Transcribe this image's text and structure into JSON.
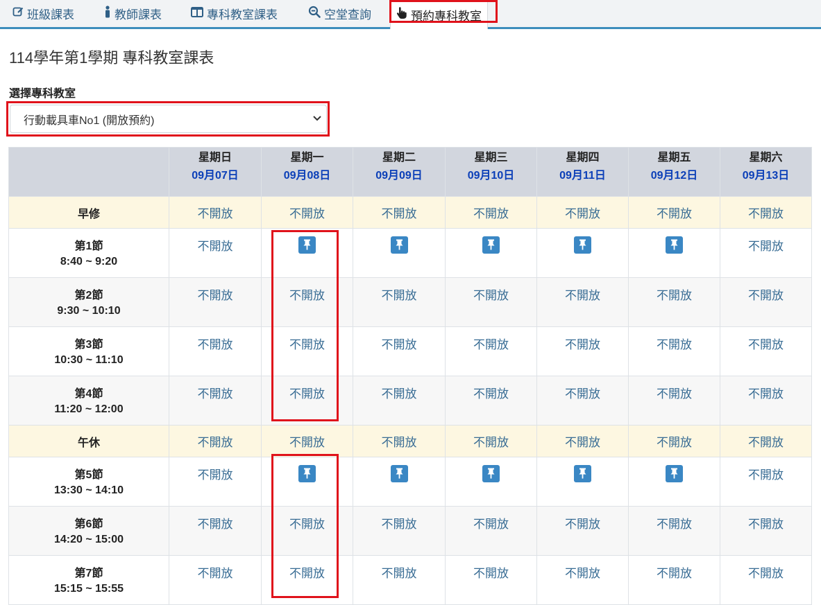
{
  "tabs": [
    {
      "label": "班級課表",
      "icon": "edit-square-icon"
    },
    {
      "label": "教師課表",
      "icon": "person-icon"
    },
    {
      "label": "專科教室課表",
      "icon": "columns-icon"
    },
    {
      "label": "空堂查詢",
      "icon": "zoom-out-icon"
    },
    {
      "label": "預約專科教室",
      "icon": "hand-pointer-icon"
    }
  ],
  "page": {
    "title": "114學年第1學期 專科教室課表",
    "select_label": "選擇專科教室",
    "selected_room": "行動載具車No1 (開放預約)"
  },
  "table": {
    "days": [
      {
        "name": "星期日",
        "date": "09月07日"
      },
      {
        "name": "星期一",
        "date": "09月08日"
      },
      {
        "name": "星期二",
        "date": "09月09日"
      },
      {
        "name": "星期三",
        "date": "09月10日"
      },
      {
        "name": "星期四",
        "date": "09月11日"
      },
      {
        "name": "星期五",
        "date": "09月12日"
      },
      {
        "name": "星期六",
        "date": "09月13日"
      }
    ],
    "closed_text": "不開放",
    "rows": [
      {
        "name": "早修",
        "time": "",
        "special": true,
        "cells": [
          "closed",
          "closed",
          "closed",
          "closed",
          "closed",
          "closed",
          "closed"
        ]
      },
      {
        "name": "第1節",
        "time": "8:40 ~ 9:20",
        "cells": [
          "closed",
          "pin",
          "pin",
          "pin",
          "pin",
          "pin",
          "closed"
        ]
      },
      {
        "name": "第2節",
        "time": "9:30 ~ 10:10",
        "cells": [
          "closed",
          "closed",
          "closed",
          "closed",
          "closed",
          "closed",
          "closed"
        ]
      },
      {
        "name": "第3節",
        "time": "10:30 ~ 11:10",
        "cells": [
          "closed",
          "closed",
          "closed",
          "closed",
          "closed",
          "closed",
          "closed"
        ]
      },
      {
        "name": "第4節",
        "time": "11:20 ~ 12:00",
        "cells": [
          "closed",
          "closed",
          "closed",
          "closed",
          "closed",
          "closed",
          "closed"
        ]
      },
      {
        "name": "午休",
        "time": "",
        "special": true,
        "cells": [
          "closed",
          "closed",
          "closed",
          "closed",
          "closed",
          "closed",
          "closed"
        ]
      },
      {
        "name": "第5節",
        "time": "13:30 ~ 14:10",
        "cells": [
          "closed",
          "pin",
          "pin",
          "pin",
          "pin",
          "pin",
          "closed"
        ]
      },
      {
        "name": "第6節",
        "time": "14:20 ~ 15:00",
        "cells": [
          "closed",
          "closed",
          "closed",
          "closed",
          "closed",
          "closed",
          "closed"
        ]
      },
      {
        "name": "第7節",
        "time": "15:15 ~ 15:55",
        "cells": [
          "closed",
          "closed",
          "closed",
          "closed",
          "closed",
          "closed",
          "closed"
        ]
      }
    ]
  },
  "colors": {
    "accent": "#3c8dbc",
    "pin_button": "#3a87c4",
    "highlight_box": "#e0121b",
    "header_bg": "#d2d6de",
    "special_row_bg": "#fdf7e1",
    "date_text": "#0b3fb8",
    "cell_text": "#386c94"
  }
}
